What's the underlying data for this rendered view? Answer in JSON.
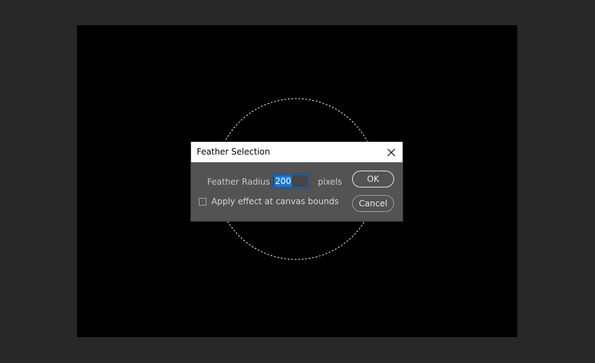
{
  "dialog": {
    "title": "Feather Selection",
    "close_icon": "close-icon",
    "feather_radius": {
      "label": "Feather Radius:",
      "value": "200",
      "unit": "pixels"
    },
    "canvas_bounds": {
      "label": "Apply effect at canvas bounds",
      "checked": false
    },
    "ok_label": "OK",
    "cancel_label": "Cancel"
  },
  "colors": {
    "workspace": "#282828",
    "canvas": "#000000",
    "dialog_body": "#535353",
    "dialog_titlebar": "#ffffff",
    "focus_accent": "#1a78d6",
    "marquee": "#ffffff"
  }
}
